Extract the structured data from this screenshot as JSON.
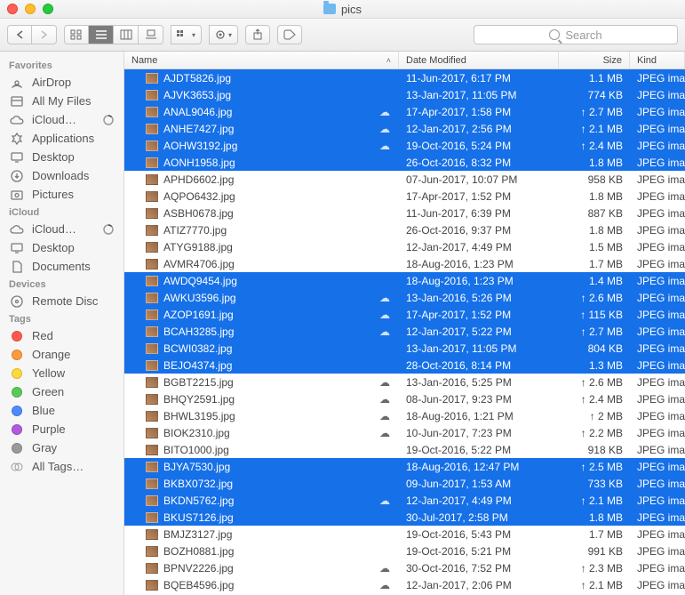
{
  "window": {
    "title": "pics"
  },
  "toolbar": {
    "search_placeholder": "Search"
  },
  "sidebar": {
    "sections": [
      {
        "title": "Favorites",
        "items": [
          {
            "icon": "airdrop",
            "label": "AirDrop"
          },
          {
            "icon": "allfiles",
            "label": "All My Files"
          },
          {
            "icon": "icloud",
            "label": "iCloud…",
            "progress": true
          },
          {
            "icon": "apps",
            "label": "Applications"
          },
          {
            "icon": "desktop",
            "label": "Desktop"
          },
          {
            "icon": "downloads",
            "label": "Downloads"
          },
          {
            "icon": "pictures",
            "label": "Pictures"
          }
        ]
      },
      {
        "title": "iCloud",
        "items": [
          {
            "icon": "icloud",
            "label": "iCloud…",
            "progress": true
          },
          {
            "icon": "desktop",
            "label": "Desktop"
          },
          {
            "icon": "documents",
            "label": "Documents"
          }
        ]
      },
      {
        "title": "Devices",
        "items": [
          {
            "icon": "disc",
            "label": "Remote Disc"
          }
        ]
      },
      {
        "title": "Tags",
        "items": [
          {
            "tag": "#ff5a4d",
            "label": "Red"
          },
          {
            "tag": "#ff9a3c",
            "label": "Orange"
          },
          {
            "tag": "#ffd93c",
            "label": "Yellow"
          },
          {
            "tag": "#5ac95a",
            "label": "Green"
          },
          {
            "tag": "#4d8bff",
            "label": "Blue"
          },
          {
            "tag": "#b15adf",
            "label": "Purple"
          },
          {
            "tag": "#9a9a9a",
            "label": "Gray"
          },
          {
            "tag": "",
            "label": "All Tags…",
            "all": true
          }
        ]
      }
    ]
  },
  "columns": {
    "name": "Name",
    "date": "Date Modified",
    "size": "Size",
    "kind": "Kind"
  },
  "files": [
    {
      "name": "AJDT5826.jpg",
      "date": "11-Jun-2017, 6:17 PM",
      "size": "1.1 MB",
      "kind": "JPEG image",
      "cloud": false,
      "up": false,
      "sel": true
    },
    {
      "name": "AJVK3653.jpg",
      "date": "13-Jan-2017, 11:05 PM",
      "size": "774 KB",
      "kind": "JPEG image",
      "cloud": false,
      "up": false,
      "sel": true
    },
    {
      "name": "ANAL9046.jpg",
      "date": "17-Apr-2017, 1:58 PM",
      "size": "2.7 MB",
      "kind": "JPEG image",
      "cloud": true,
      "up": true,
      "sel": true
    },
    {
      "name": "ANHE7427.jpg",
      "date": "12-Jan-2017, 2:56 PM",
      "size": "2.1 MB",
      "kind": "JPEG image",
      "cloud": true,
      "up": true,
      "sel": true
    },
    {
      "name": "AOHW3192.jpg",
      "date": "19-Oct-2016, 5:24 PM",
      "size": "2.4 MB",
      "kind": "JPEG image",
      "cloud": true,
      "up": true,
      "sel": true
    },
    {
      "name": "AONH1958.jpg",
      "date": "26-Oct-2016, 8:32 PM",
      "size": "1.8 MB",
      "kind": "JPEG image",
      "cloud": false,
      "up": false,
      "sel": true
    },
    {
      "name": "APHD6602.jpg",
      "date": "07-Jun-2017, 10:07 PM",
      "size": "958 KB",
      "kind": "JPEG image",
      "cloud": false,
      "up": false,
      "sel": false
    },
    {
      "name": "AQPO6432.jpg",
      "date": "17-Apr-2017, 1:52 PM",
      "size": "1.8 MB",
      "kind": "JPEG image",
      "cloud": false,
      "up": false,
      "sel": false
    },
    {
      "name": "ASBH0678.jpg",
      "date": "11-Jun-2017, 6:39 PM",
      "size": "887 KB",
      "kind": "JPEG image",
      "cloud": false,
      "up": false,
      "sel": false
    },
    {
      "name": "ATIZ7770.jpg",
      "date": "26-Oct-2016, 9:37 PM",
      "size": "1.8 MB",
      "kind": "JPEG image",
      "cloud": false,
      "up": false,
      "sel": false
    },
    {
      "name": "ATYG9188.jpg",
      "date": "12-Jan-2017, 4:49 PM",
      "size": "1.5 MB",
      "kind": "JPEG image",
      "cloud": false,
      "up": false,
      "sel": false
    },
    {
      "name": "AVMR4706.jpg",
      "date": "18-Aug-2016, 1:23 PM",
      "size": "1.7 MB",
      "kind": "JPEG image",
      "cloud": false,
      "up": false,
      "sel": false
    },
    {
      "name": "AWDQ9454.jpg",
      "date": "18-Aug-2016, 1:23 PM",
      "size": "1.4 MB",
      "kind": "JPEG image",
      "cloud": false,
      "up": false,
      "sel": true
    },
    {
      "name": "AWKU3596.jpg",
      "date": "13-Jan-2016, 5:26 PM",
      "size": "2.6 MB",
      "kind": "JPEG image",
      "cloud": true,
      "up": true,
      "sel": true
    },
    {
      "name": "AZOP1691.jpg",
      "date": "17-Apr-2017, 1:52 PM",
      "size": "115 KB",
      "kind": "JPEG image",
      "cloud": true,
      "up": true,
      "sel": true
    },
    {
      "name": "BCAH3285.jpg",
      "date": "12-Jan-2017, 5:22 PM",
      "size": "2.7 MB",
      "kind": "JPEG image",
      "cloud": true,
      "up": true,
      "sel": true
    },
    {
      "name": "BCWI0382.jpg",
      "date": "13-Jan-2017, 11:05 PM",
      "size": "804 KB",
      "kind": "JPEG image",
      "cloud": false,
      "up": false,
      "sel": true
    },
    {
      "name": "BEJO4374.jpg",
      "date": "28-Oct-2016, 8:14 PM",
      "size": "1.3 MB",
      "kind": "JPEG image",
      "cloud": false,
      "up": false,
      "sel": true
    },
    {
      "name": "BGBT2215.jpg",
      "date": "13-Jan-2016, 5:25 PM",
      "size": "2.6 MB",
      "kind": "JPEG image",
      "cloud": true,
      "up": true,
      "sel": false
    },
    {
      "name": "BHQY2591.jpg",
      "date": "08-Jun-2017, 9:23 PM",
      "size": "2.4 MB",
      "kind": "JPEG image",
      "cloud": true,
      "up": true,
      "sel": false
    },
    {
      "name": "BHWL3195.jpg",
      "date": "18-Aug-2016, 1:21 PM",
      "size": "2 MB",
      "kind": "JPEG image",
      "cloud": true,
      "up": true,
      "sel": false
    },
    {
      "name": "BIOK2310.jpg",
      "date": "10-Jun-2017, 7:23 PM",
      "size": "2.2 MB",
      "kind": "JPEG image",
      "cloud": true,
      "up": true,
      "sel": false
    },
    {
      "name": "BITO1000.jpg",
      "date": "19-Oct-2016, 5:22 PM",
      "size": "918 KB",
      "kind": "JPEG image",
      "cloud": false,
      "up": false,
      "sel": false
    },
    {
      "name": "BJYA7530.jpg",
      "date": "18-Aug-2016, 12:47 PM",
      "size": "2.5 MB",
      "kind": "JPEG image",
      "cloud": false,
      "up": true,
      "sel": true
    },
    {
      "name": "BKBX0732.jpg",
      "date": "09-Jun-2017, 1:53 AM",
      "size": "733 KB",
      "kind": "JPEG image",
      "cloud": false,
      "up": false,
      "sel": true
    },
    {
      "name": "BKDN5762.jpg",
      "date": "12-Jan-2017, 4:49 PM",
      "size": "2.1 MB",
      "kind": "JPEG image",
      "cloud": true,
      "up": true,
      "sel": true
    },
    {
      "name": "BKUS7126.jpg",
      "date": "30-Jul-2017, 2:58 PM",
      "size": "1.8 MB",
      "kind": "JPEG image",
      "cloud": false,
      "up": false,
      "sel": true
    },
    {
      "name": "BMJZ3127.jpg",
      "date": "19-Oct-2016, 5:43 PM",
      "size": "1.7 MB",
      "kind": "JPEG image",
      "cloud": false,
      "up": false,
      "sel": false
    },
    {
      "name": "BOZH0881.jpg",
      "date": "19-Oct-2016, 5:21 PM",
      "size": "991 KB",
      "kind": "JPEG image",
      "cloud": false,
      "up": false,
      "sel": false
    },
    {
      "name": "BPNV2226.jpg",
      "date": "30-Oct-2016, 7:52 PM",
      "size": "2.3 MB",
      "kind": "JPEG image",
      "cloud": true,
      "up": true,
      "sel": false
    },
    {
      "name": "BQEB4596.jpg",
      "date": "12-Jan-2017, 2:06 PM",
      "size": "2.1 MB",
      "kind": "JPEG image",
      "cloud": true,
      "up": true,
      "sel": false
    }
  ]
}
